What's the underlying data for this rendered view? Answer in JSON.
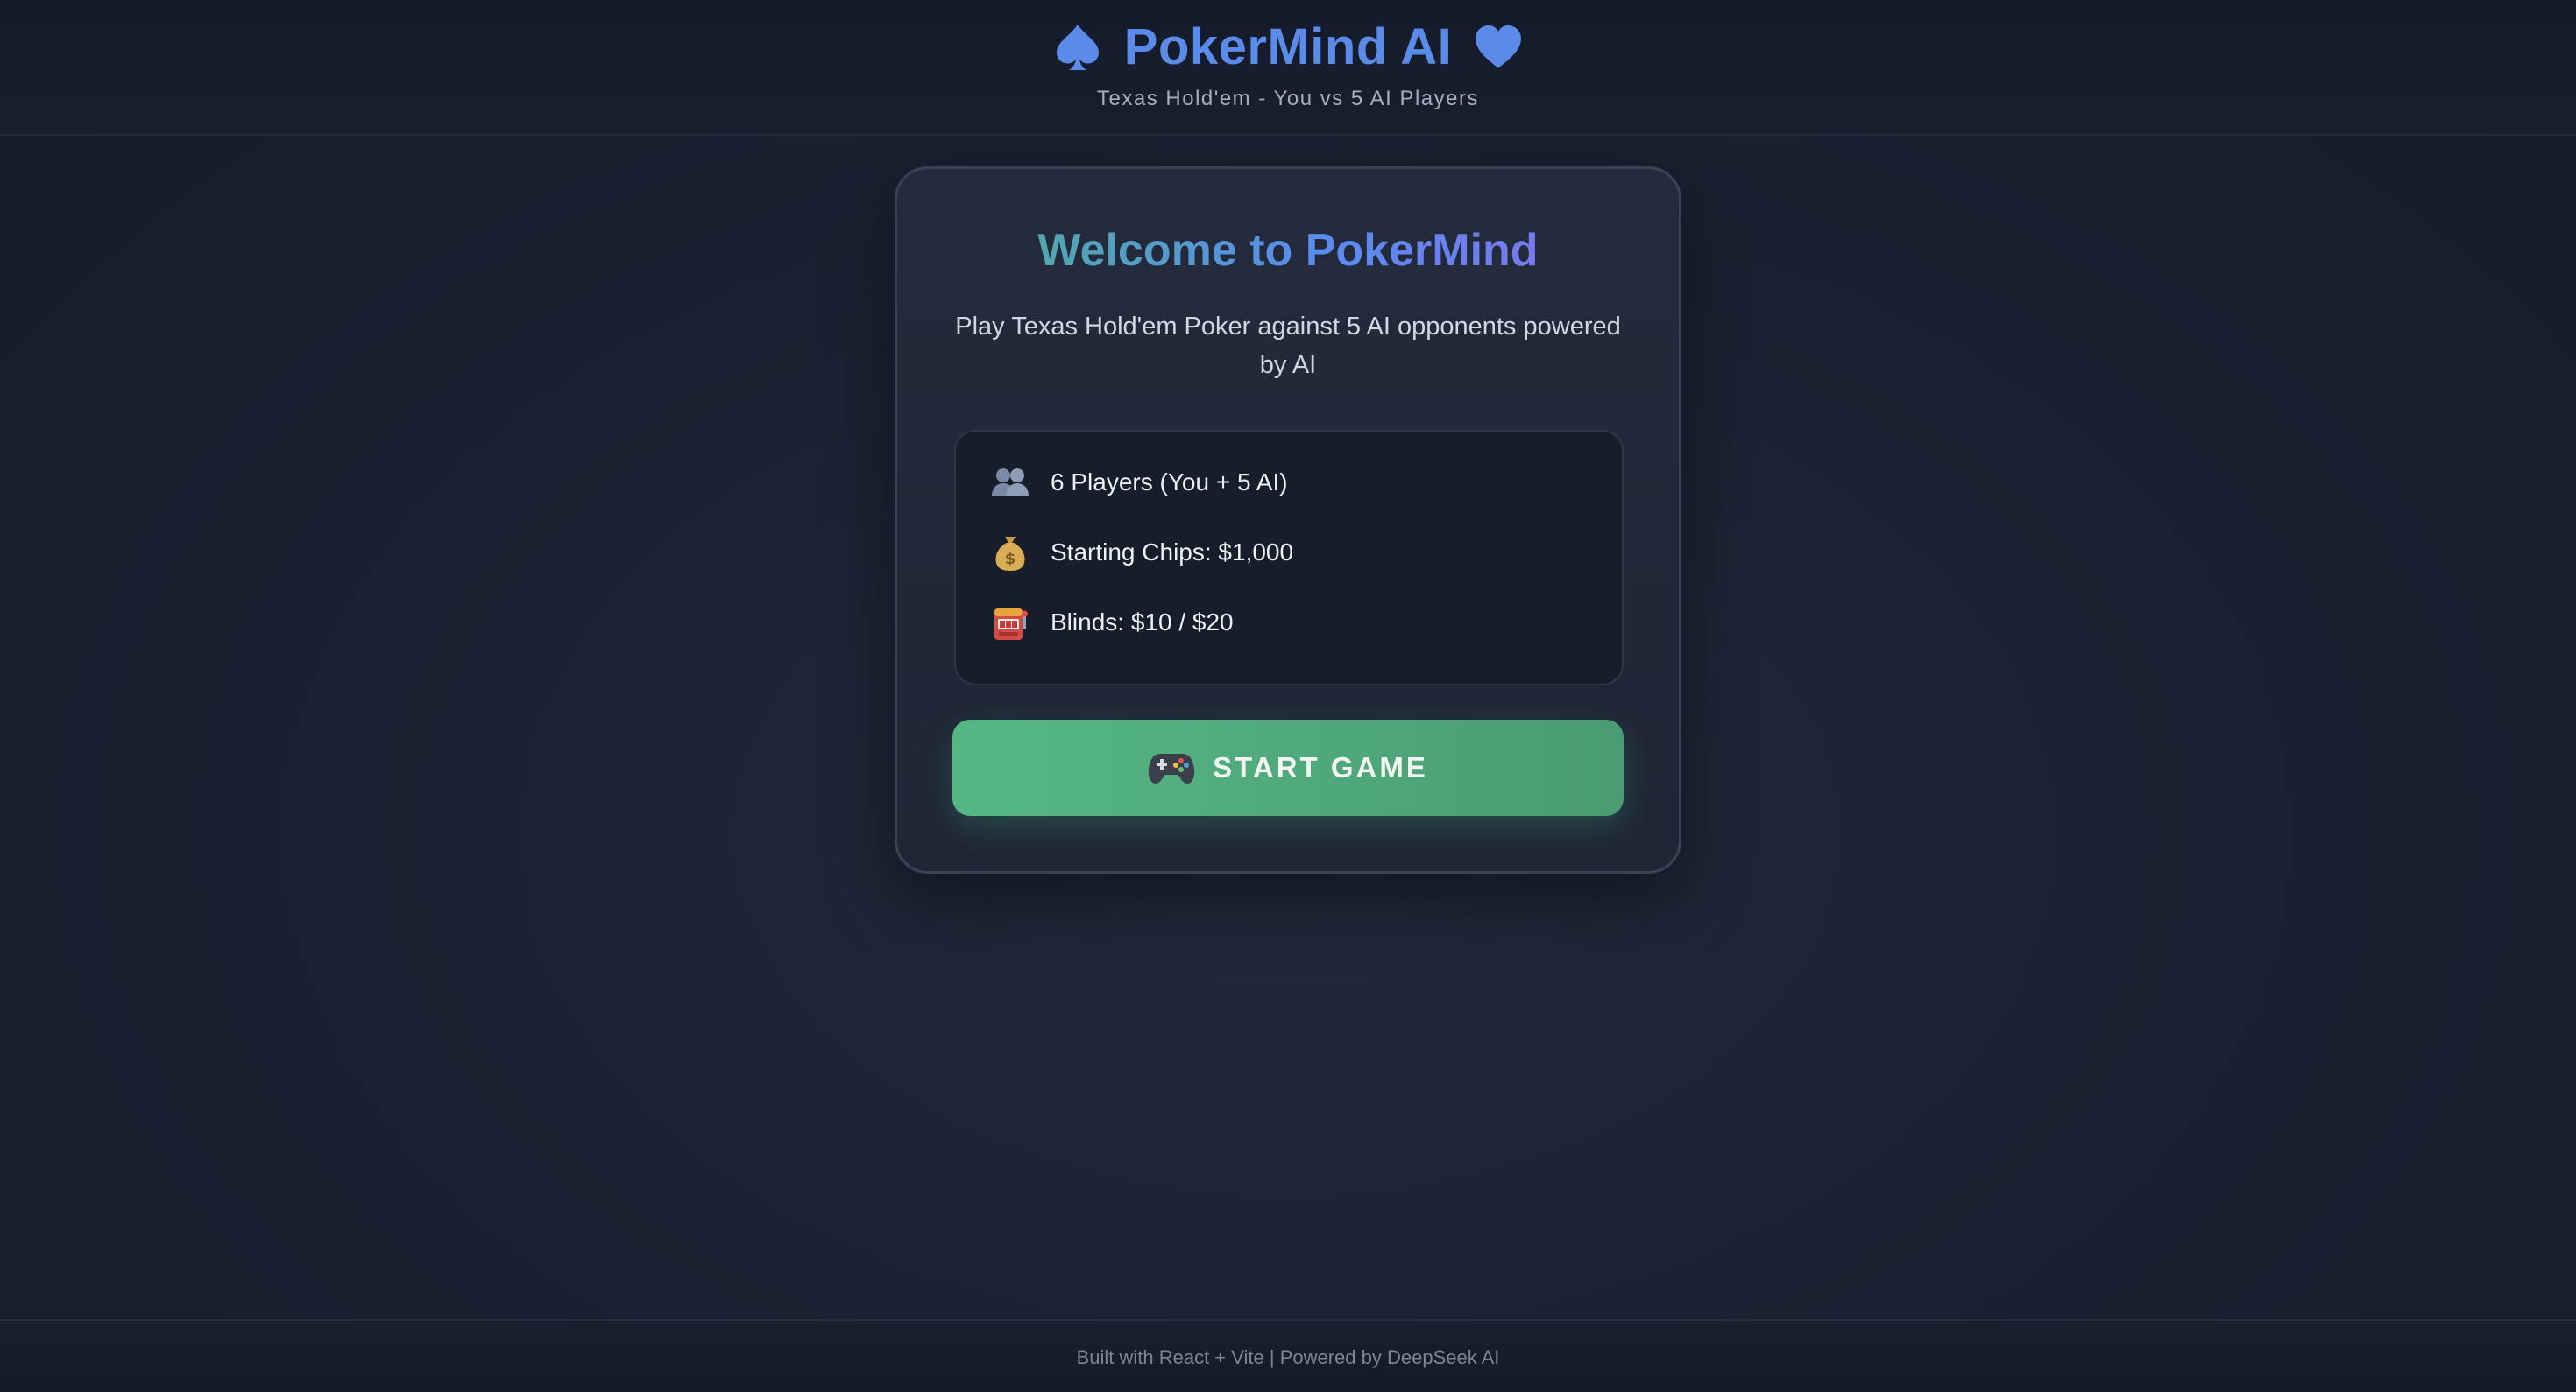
{
  "header": {
    "title": "PokerMind AI",
    "subtitle": "Texas Hold'em - You vs 5 AI Players",
    "left_icon": "spade-icon",
    "right_icon": "heart-icon",
    "accent_color": "#5b8be8"
  },
  "welcome": {
    "title": "Welcome to PokerMind",
    "description": "Play Texas Hold'em Poker against 5 AI opponents powered by AI",
    "features": [
      {
        "icon": "players-icon",
        "label": "6 Players (You + 5 AI)"
      },
      {
        "icon": "money-bag-icon",
        "label": "Starting Chips: $1,000"
      },
      {
        "icon": "slot-machine-icon",
        "label": "Blinds: $10 / $20"
      }
    ],
    "start_button": {
      "icon": "gamepad-icon",
      "label": "START GAME",
      "color": "#55b884"
    }
  },
  "footer": {
    "text": "Built with React + Vite | Powered by DeepSeek AI"
  }
}
